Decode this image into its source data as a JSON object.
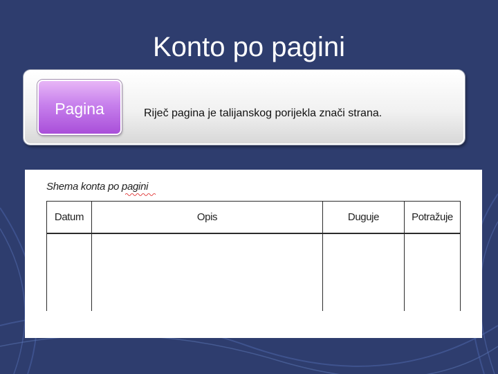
{
  "slide": {
    "title": "Konto po pagini"
  },
  "definition": {
    "term": "Pagina",
    "text": "Riječ pagina je talijanskog porijekla znači strana."
  },
  "scheme": {
    "title": "Shema konta po pagini",
    "columns": [
      "Datum",
      "Opis",
      "Duguje",
      "Potražuje"
    ]
  },
  "colors": {
    "background": "#2e3d6e",
    "tag": "#c780ec"
  }
}
